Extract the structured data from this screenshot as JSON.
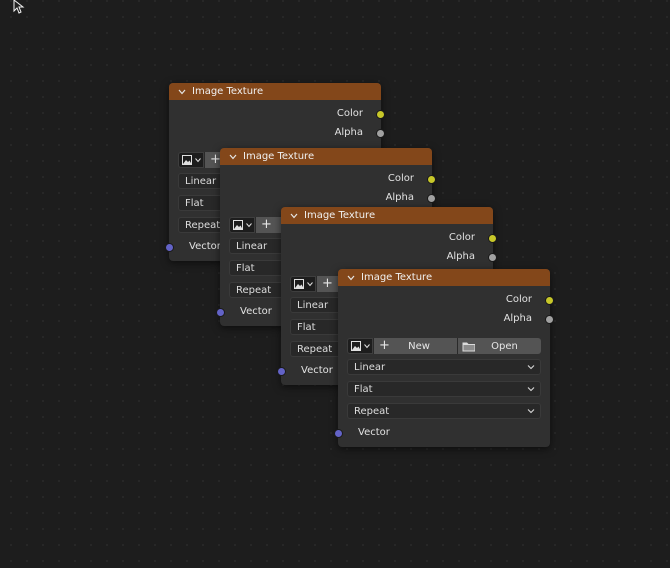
{
  "nodes": [
    {
      "title": "Image Texture",
      "outputs": [
        "Color",
        "Alpha"
      ],
      "image_buttons": {
        "new_label": "New",
        "open_label": "Open"
      },
      "interpolation": "Linear",
      "projection": "Flat",
      "extension": "Repeat",
      "input": "Vector"
    },
    {
      "title": "Image Texture",
      "outputs": [
        "Color",
        "Alpha"
      ],
      "image_buttons": {
        "new_label": "New",
        "open_label": "Open"
      },
      "interpolation": "Linear",
      "projection": "Flat",
      "extension": "Repeat",
      "input": "Vector"
    },
    {
      "title": "Image Texture",
      "outputs": [
        "Color",
        "Alpha"
      ],
      "image_buttons": {
        "new_label": "New",
        "open_label": "Open"
      },
      "interpolation": "Linear",
      "projection": "Flat",
      "extension": "Repeat",
      "input": "Vector"
    },
    {
      "title": "Image Texture",
      "outputs": [
        "Color",
        "Alpha"
      ],
      "image_buttons": {
        "new_label": "New",
        "open_label": "Open"
      },
      "interpolation": "Linear",
      "projection": "Flat",
      "extension": "Repeat",
      "input": "Vector"
    }
  ],
  "colors": {
    "header": "#83471a",
    "body": "#303030",
    "color_socket": "#c7c729",
    "alpha_socket": "#a1a1a1",
    "vector_socket": "#6363c7",
    "canvas": "#1d1d1d"
  },
  "icons": [
    "cursor-icon",
    "chevron-down-icon",
    "image-icon",
    "plus-icon",
    "folder-icon",
    "dropdown-arrow-icon"
  ]
}
